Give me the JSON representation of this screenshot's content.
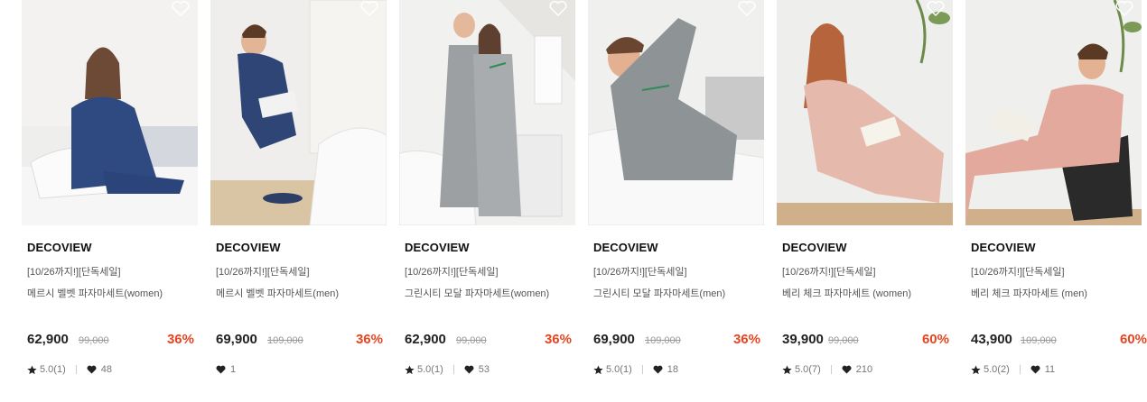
{
  "colors": {
    "discount": "#e8441f",
    "text": "#222222",
    "muted": "#777777"
  },
  "products": [
    {
      "brand": "DECOVIEW",
      "promo": "[10/26까지!][단독세일]",
      "name": "메르시 벨벳 파자마세트(women)",
      "price": "62,900",
      "original_price": "99,000",
      "discount": "36%",
      "rating": "5.0(1)",
      "likes": "48",
      "image": "navy-velvet-women"
    },
    {
      "brand": "DECOVIEW",
      "promo": "[10/26까지!][단독세일]",
      "name": "메르시 벨벳 파자마세트(men)",
      "price": "69,900",
      "original_price": "109,000",
      "discount": "36%",
      "rating": "",
      "likes": "1",
      "image": "navy-velvet-men"
    },
    {
      "brand": "DECOVIEW",
      "promo": "[10/26까지!][단독세일]",
      "name": "그린시티 모달 파자마세트(women)",
      "price": "62,900",
      "original_price": "99,000",
      "discount": "36%",
      "rating": "5.0(1)",
      "likes": "53",
      "image": "grey-stripe-couple"
    },
    {
      "brand": "DECOVIEW",
      "promo": "[10/26까지!][단독세일]",
      "name": "그린시티 모달 파자마세트(men)",
      "price": "69,900",
      "original_price": "109,000",
      "discount": "36%",
      "rating": "5.0(1)",
      "likes": "18",
      "image": "grey-stripe-men"
    },
    {
      "brand": "DECOVIEW",
      "promo": "[10/26까지!][단독세일]",
      "name": "베리 체크 파자마세트 (women)",
      "price": "39,900",
      "original_price": "99,000",
      "discount": "60%",
      "rating": "5.0(7)",
      "likes": "210",
      "image": "pink-check-women"
    },
    {
      "brand": "DECOVIEW",
      "promo": "[10/26까지!][단독세일]",
      "name": "베리 체크 파자마세트 (men)",
      "price": "43,900",
      "original_price": "109,000",
      "discount": "60%",
      "rating": "5.0(2)",
      "likes": "11",
      "image": "pink-check-men"
    }
  ]
}
